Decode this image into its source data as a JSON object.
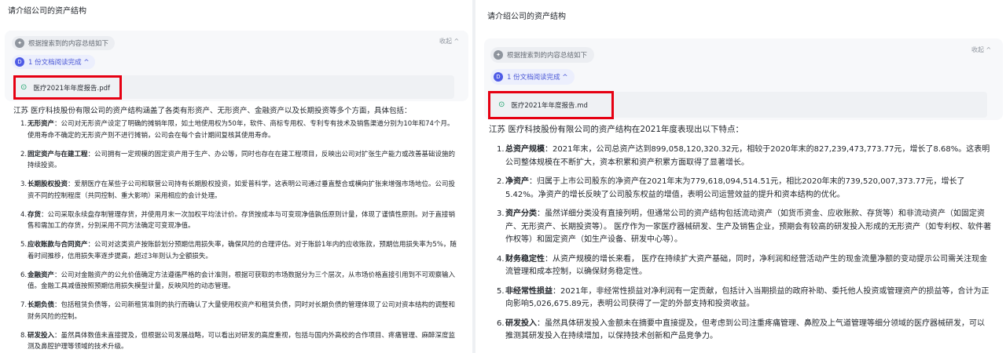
{
  "panels": [
    {
      "question": "请介绍公司的资产结构",
      "summary_chip": "根据搜索到的内容总结如下",
      "collapse_label": "收起 ^",
      "docs_chip": "1 份文档阅读完成 ^",
      "docs_badge": "D",
      "file_name": "医疗2021年年度报告.pdf",
      "intro": "江苏        医疗科技股份有限公司的资产结构涵盖了各类有形资产、无形资产、金融资产以及长期投资等多个方面，具体包括：",
      "items": [
        {
          "num": "1.",
          "title": "无形资产",
          "text": "：公司对无形资产设定了明确的摊销年限，如土地使用权为50年，软件、商标专用权、专利专有技术及销售渠道分别为10年和74个月。使用寿命不确定的无形资产则不进行摊销，公司会在每个会计期间复核其使用寿命。"
        },
        {
          "num": "2.",
          "title": "固定资产与在建工程",
          "text": "：公司拥有一定规模的固定资产用于生产、办公等，同时也存在在建工程项目，反映出公司对扩张生产能力或改善基础设施的持续投资。"
        },
        {
          "num": "3.",
          "title": "长期股权投资",
          "text": "：爱朋医疗在某些子公司和联营公司持有长期股权投资，如爱普科学，这表明公司通过垂直整合或横向扩张来增强市场地位。公司投资不同的控制程度（共同控制、重大影响）采用相应的会计处理。"
        },
        {
          "num": "4.",
          "title": "存货",
          "text": "：公司采取永续盘存制管理存货，并使用月末一次加权平均法计价。存货按成本与可变现净值孰低原则计量，体现了谨慎性原则。对于直接销售和需加工的存货，分别采用不同方法确定可变现净值。"
        },
        {
          "num": "5.",
          "title": "应收账款与合同资产",
          "text": "：公司对这类资产按账龄划分预期信用损失率，确保风险的合理评估。对于账龄1年内的应收账款，预期信用损失率为5%，随着时间推移，信用损失率逐步提高，超过3年则认为全额损失。"
        },
        {
          "num": "6.",
          "title": "金融资产",
          "text": "：公司对金融资产的公允价值确定方法遵循严格的会计准则，根据可获取的市场数据分为三个层次，从市场价格直接引用到不可观察输入值。金融工具减值按照预期信用损失模型计量，反映风险的动态管理。"
        },
        {
          "num": "7.",
          "title": "长期负债",
          "text": "：包括租赁负债等，公司新租赁准则的执行而确认了大量使用权资产和租赁负债，同时对长期负债的管理体现了公司对资本结构的调整和财务风险的控制。"
        },
        {
          "num": "8.",
          "title": "研发投入",
          "text": "：虽然具体数值未直接提及，但根据公司发展战略，可以看出对研发的高度重视，包括与国内外高校的合作项目、疼痛管理、麻醉深度监测及鼻腔护理等领域的技术升级。"
        }
      ]
    },
    {
      "question": "请介绍公司的资产结构",
      "summary_chip": "根据搜索到的内容总结如下",
      "collapse_label": "收起 ^",
      "docs_chip": "1 份文档阅读完成 ^",
      "docs_badge": "D",
      "file_name": "医疗2021年年度报告.md",
      "intro": "江苏        医疗科技股份有限公司的资产结构在2021年度表现出以下特点：",
      "items": [
        {
          "num": "1.",
          "title": "总资产规模",
          "text": "：2021年末，公司总资产达到899,058,120,320.32元，相较于2020年末的827,239,473,773.77元，增长了8.68%。这表明公司整体规模在不断扩大，资本积累和资产积累方面取得了显著增长。"
        },
        {
          "num": "2.",
          "title": "净资产",
          "text": "：归属于上市公司股东的净资产在2021年末为779,618,094,514.51元，相比2020年末的739,520,007,373.77元，增长了5.42%。净资产的增长反映了公司股东权益的增值，表明公司运营效益的提升和资本结构的优化。"
        },
        {
          "num": "3.",
          "title": "资产分类",
          "text": "：虽然详细分类没有直接列明，但通常公司的资产结构包括流动资产（如货币资金、应收账款、存货等）和非流动资产（如固定资产、无形资产、长期投资等）。     医疗作为一家医疗器械研发、生产及销售企业，预期会有较高的研发投入形成的无形资产（如专利权、软件著作权等）和固定资产（如生产设备、研发中心等）。"
        },
        {
          "num": "4.",
          "title": "财务稳定性",
          "text": "：从资产规模的增长来看，     医疗在持续扩大资产基础，同时，净利润和经营活动产生的现金流量净额的变动提示公司需关注现金流管理和成本控制，以确保财务稳定性。"
        },
        {
          "num": "5.",
          "title": "非经常性损益",
          "text": "：2021年，非经常性损益对净利润有一定贡献，包括计入当期损益的政府补助、委托他人投资或管理资产的损益等，合计为正向影响5,026,675.89元，表明公司获得了一定的外部支持和投资收益。"
        },
        {
          "num": "6.",
          "title": "研发投入",
          "text": "：虽然具体研发投入金额未在摘要中直接提及，但考虑到公司注重疼痛管理、鼻腔及上气道管理等细分领域的医疗器械研发，可以推测其研发投入在持续增加，以保持技术创新和产品竞争力。"
        }
      ]
    }
  ]
}
